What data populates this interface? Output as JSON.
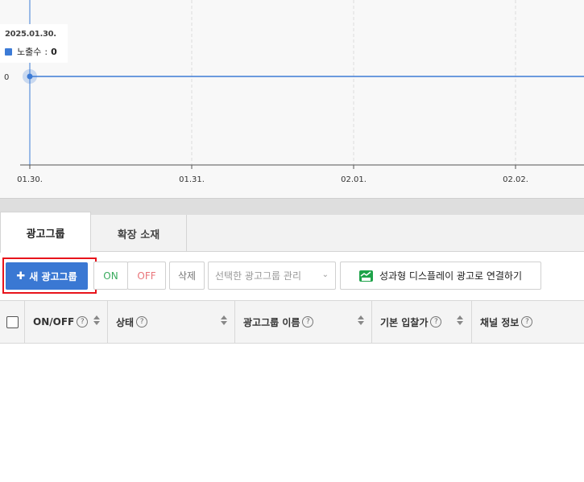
{
  "chart_data": {
    "type": "line",
    "x": [
      "01.30.",
      "01.31.",
      "02.01.",
      "02.02."
    ],
    "series": [
      {
        "name": "노출수",
        "values": [
          0,
          0,
          0,
          0
        ]
      }
    ],
    "y_tick_labels": [
      "0"
    ],
    "color": "#3c7bd6",
    "grid": "vertical dashed"
  },
  "tooltip": {
    "date": "2025.01.30.",
    "series_name": "노출수",
    "separator": ":",
    "value": "0"
  },
  "tabs": [
    {
      "label": "광고그룹",
      "active": true
    },
    {
      "label": "확장 소재",
      "active": false
    }
  ],
  "toolbar": {
    "new_group_label": "새 광고그룹",
    "on_label": "ON",
    "off_label": "OFF",
    "delete_label": "삭제",
    "manage_select_value": "선택한 광고그룹 관리",
    "connect_label": "성과형 디스플레이 광고로 연결하기"
  },
  "table": {
    "columns": [
      {
        "label": "ON/OFF",
        "help": "?"
      },
      {
        "label": "상태",
        "help": "?"
      },
      {
        "label": "광고그룹 이름",
        "help": "?"
      },
      {
        "label": "기본 입찰가",
        "help": "?"
      },
      {
        "label": "채널 정보",
        "help": "?"
      }
    ]
  },
  "icons": {
    "plus": "plus-icon",
    "help": "question-circle-icon",
    "sort": "sort-icon",
    "chevron": "chevron-down-icon",
    "ad": "ad-chart-icon"
  }
}
